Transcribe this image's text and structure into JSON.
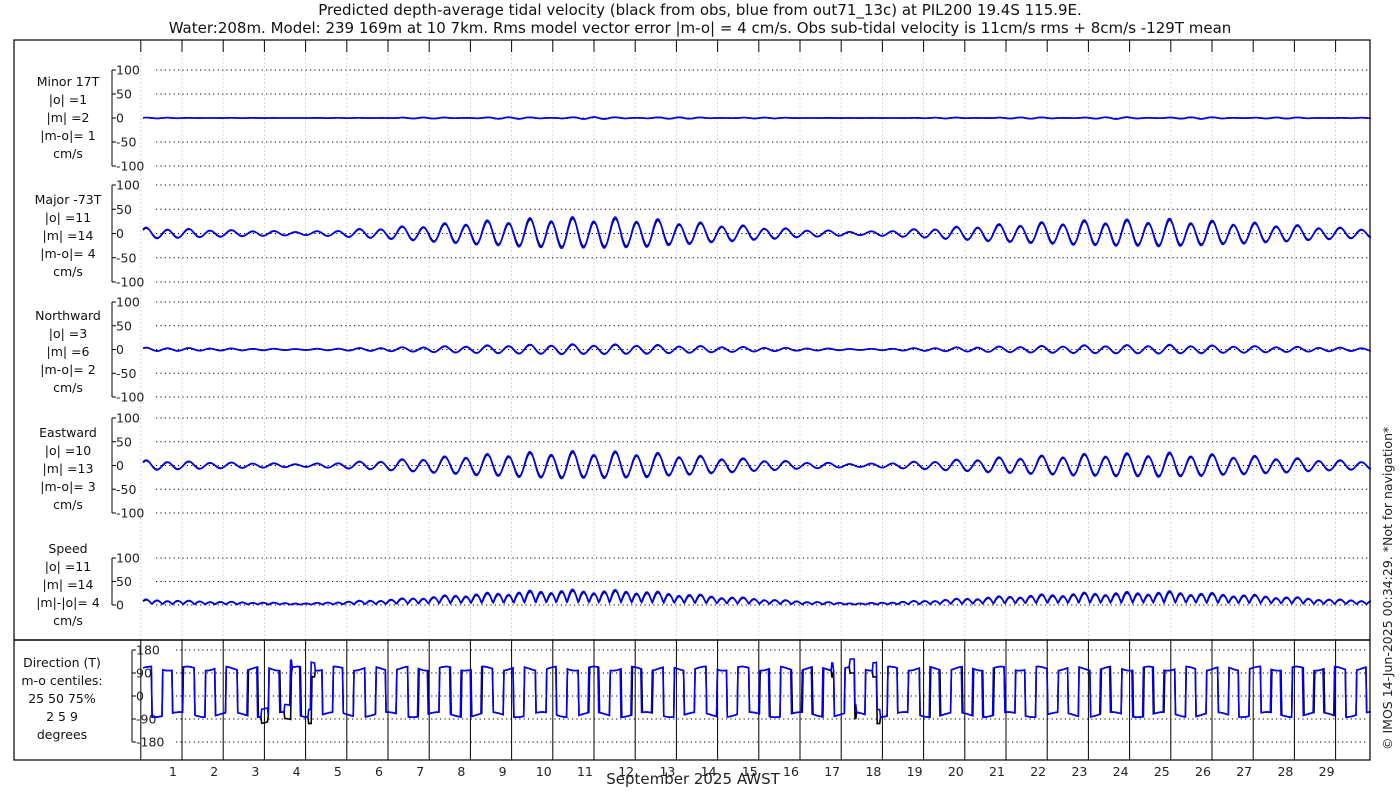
{
  "chart_data": {
    "type": "line",
    "title": "Predicted depth-average tidal velocity (black from obs, blue from out71_13c) at PIL200 19.4S 115.9E.",
    "subtitle": "Water:208m. Model: 239 169m at 10 7km. Rms model vector error |m-o| = 4 cm/s. Obs sub-tidal velocity is 11cm/s rms + 8cm/s -129T mean",
    "xlabel": "September 2025 AWST",
    "x_ticks": [
      "1",
      "2",
      "3",
      "4",
      "5",
      "6",
      "7",
      "8",
      "9",
      "10",
      "11",
      "12",
      "13",
      "14",
      "15",
      "16",
      "17",
      "18",
      "19",
      "20",
      "21",
      "22",
      "23",
      "24",
      "25",
      "26",
      "27",
      "28",
      "29"
    ],
    "x_range_days": [
      0.05,
      29.85
    ],
    "tidal_period_days": 0.5175,
    "major_amplitude_envelope_days": [
      0,
      2,
      4,
      6,
      8,
      10,
      12,
      14,
      16,
      17.5,
      19,
      21,
      23,
      25,
      27,
      29,
      30
    ],
    "major_amplitude_envelope_cms": [
      10,
      6,
      3,
      10,
      20,
      27,
      26,
      16,
      7,
      3,
      8,
      16,
      22,
      24,
      18,
      10,
      8
    ],
    "series_colors": {
      "obs": "#000000",
      "model": "#0000ff"
    },
    "panels": [
      {
        "id": "minor",
        "labels": [
          "Minor 17T",
          "|o| =1",
          "|m| =2",
          "|m-o|= 1",
          "cm/s"
        ],
        "yticks": [
          "100",
          "50",
          "0",
          "-50",
          "-100"
        ],
        "ylim": [
          -100,
          100
        ],
        "scale": 0.08
      },
      {
        "id": "major",
        "labels": [
          "Major -73T",
          "|o| =11",
          "|m| =14",
          "|m-o|= 4",
          "cm/s"
        ],
        "yticks": [
          "100",
          "50",
          "0",
          "-50",
          "-100"
        ],
        "ylim": [
          -100,
          100
        ],
        "scale": 1.0
      },
      {
        "id": "north",
        "labels": [
          "Northward",
          "|o| =3",
          "|m| =6",
          "|m-o|= 2",
          "cm/s"
        ],
        "yticks": [
          "100",
          "50",
          "0",
          "-50",
          "-100"
        ],
        "ylim": [
          -100,
          100
        ],
        "scale": 0.33
      },
      {
        "id": "east",
        "labels": [
          "Eastward",
          "|o| =10",
          "|m| =13",
          "|m-o|= 3",
          "cm/s"
        ],
        "yticks": [
          "100",
          "50",
          "0",
          "-50",
          "-100"
        ],
        "ylim": [
          -100,
          100
        ],
        "scale": 0.9
      },
      {
        "id": "speed",
        "labels": [
          "Speed",
          "|o| =11",
          "|m| =14",
          "|m|-|o|= 4",
          "cm/s"
        ],
        "yticks": [
          "100",
          "50",
          "0"
        ],
        "ylim": [
          0,
          100
        ],
        "scale": 1.0
      },
      {
        "id": "direction",
        "labels": [
          "Direction (T)",
          "m-o centiles:",
          "25  50  75%",
          "2  5  9",
          "degrees"
        ],
        "yticks": [
          "180",
          "90",
          "0",
          "-90",
          "-180"
        ],
        "ylim": [
          -180,
          180
        ],
        "flood_dir": 107,
        "ebb_dir": -73
      }
    ]
  },
  "footer_note": "© IMOS 14-Jun-2025 00:34:29. *Not for navigation*"
}
